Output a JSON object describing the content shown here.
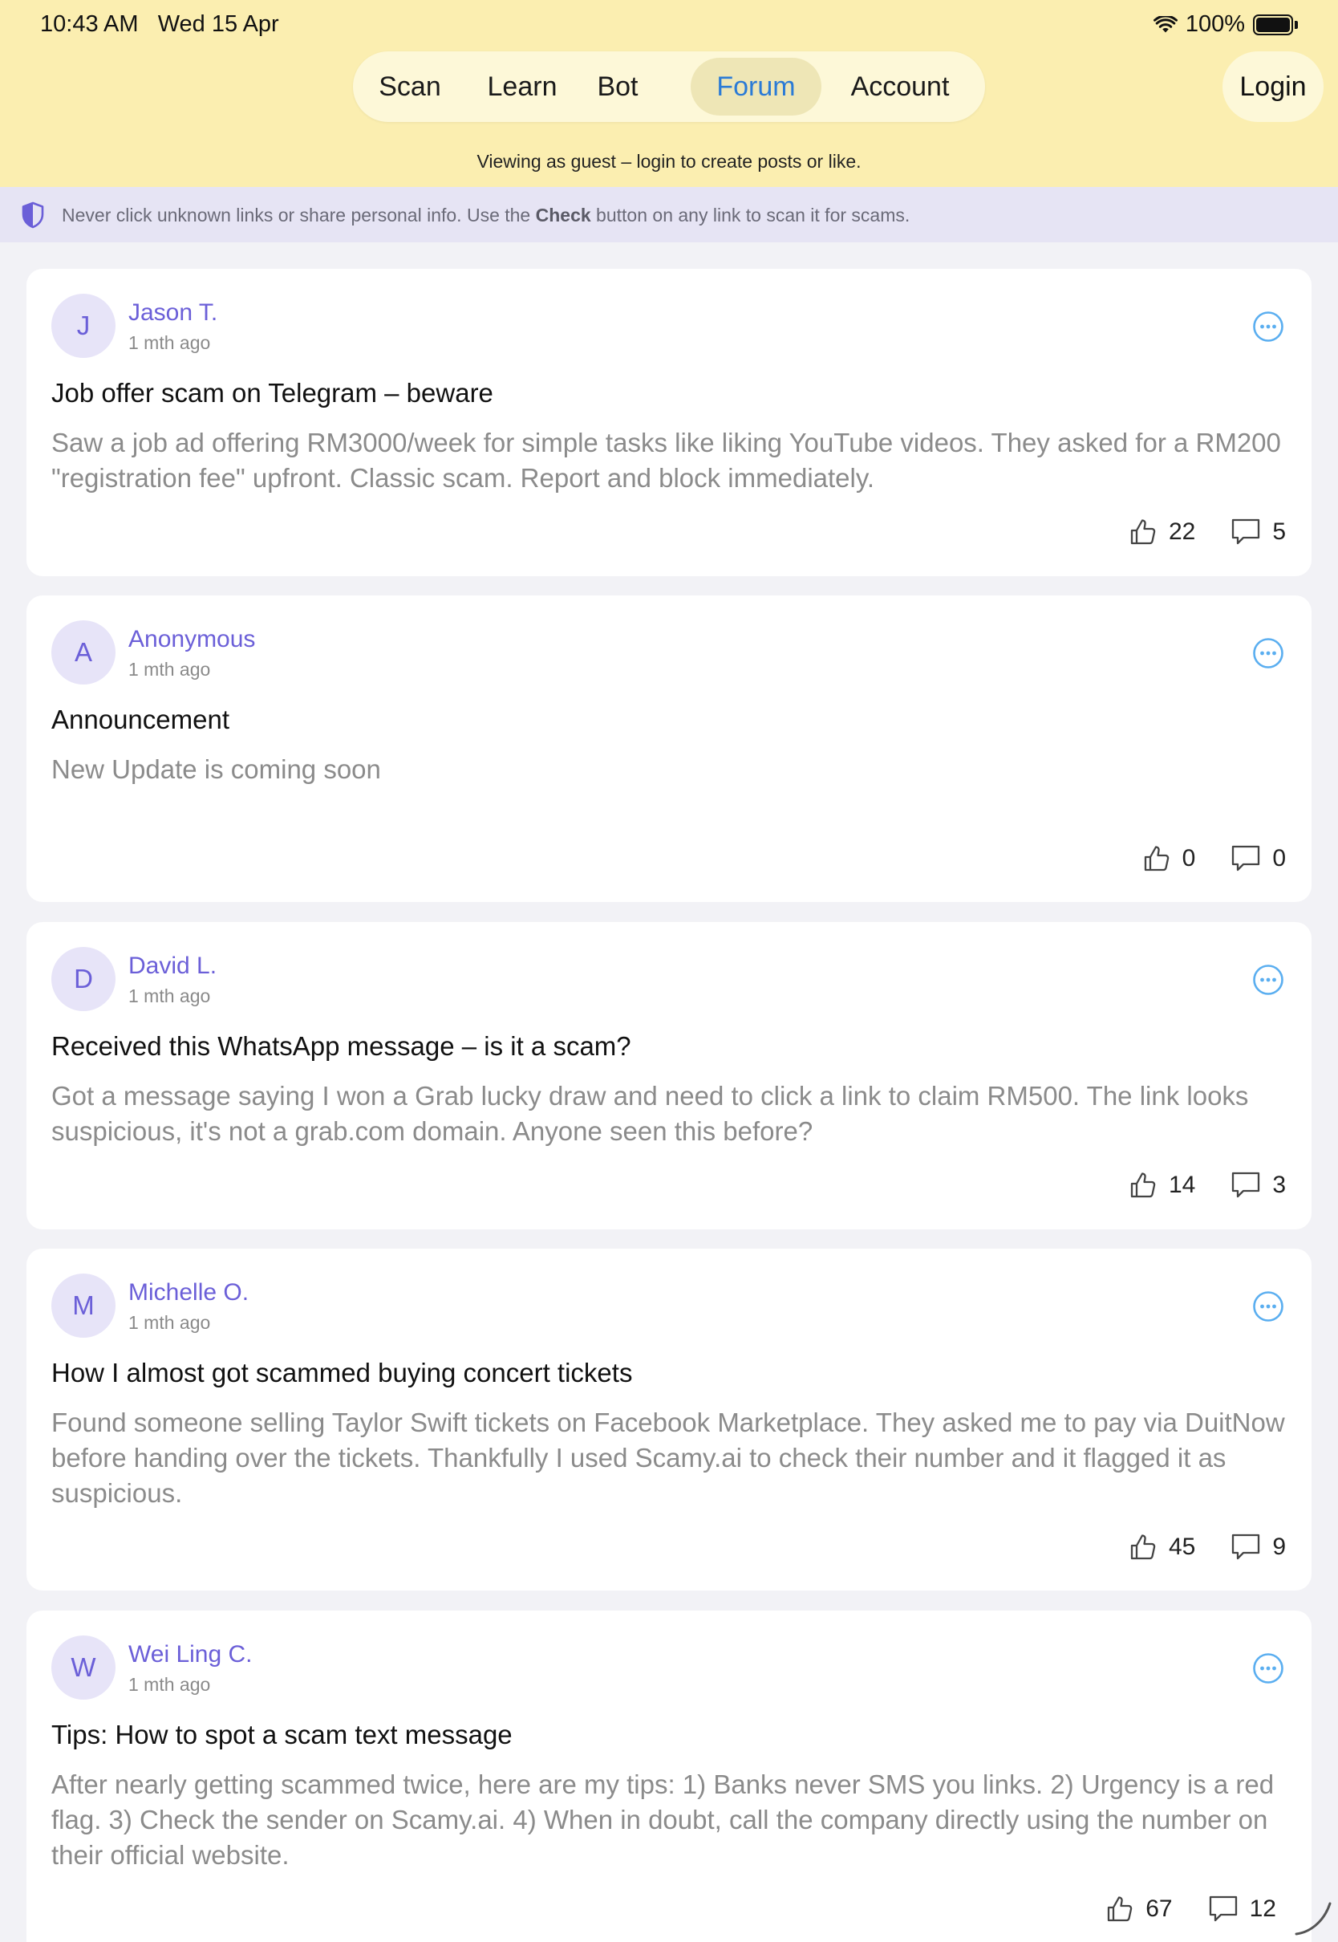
{
  "status": {
    "time": "10:43 AM",
    "date": "Wed 15 Apr",
    "battery": "100%"
  },
  "nav": {
    "tabs": [
      {
        "label": "Scan"
      },
      {
        "label": "Learn"
      },
      {
        "label": "Bot"
      },
      {
        "label": "Forum"
      },
      {
        "label": "Account"
      }
    ],
    "active": "Forum",
    "login_label": "Login"
  },
  "guest_note": "Viewing as guest – login to create posts or like.",
  "banner": {
    "text_before": "Never click unknown links or share personal info. Use the ",
    "text_bold": "Check",
    "text_after": " button on any link to scan it for scams."
  },
  "posts": [
    {
      "initial": "J",
      "author": "Jason T.",
      "time": "1 mth ago",
      "title": "Job offer scam on Telegram – beware",
      "body": "Saw a job ad offering RM3000/week for simple tasks like liking YouTube videos. They asked for a RM200 \"registration fee\" upfront. Classic scam. Report and block immediately.",
      "likes": "22",
      "comments": "5"
    },
    {
      "initial": "A",
      "author": "Anonymous",
      "time": "1 mth ago",
      "title": "Announcement",
      "body": "New Update is coming soon",
      "likes": "0",
      "comments": "0"
    },
    {
      "initial": "D",
      "author": "David L.",
      "time": "1 mth ago",
      "title": "Received this WhatsApp message – is it a scam?",
      "body": "Got a message saying I won a Grab lucky draw and need to click a link to claim RM500. The link looks suspicious, it's not a grab.com domain. Anyone seen this before?",
      "likes": "14",
      "comments": "3"
    },
    {
      "initial": "M",
      "author": "Michelle O.",
      "time": "1 mth ago",
      "title": "How I almost got scammed buying concert tickets",
      "body": "Found someone selling Taylor Swift tickets on Facebook Marketplace. They asked me to pay via DuitNow before handing over the tickets. Thankfully I used Scamy.ai to check their number and it flagged it as suspicious.",
      "likes": "45",
      "comments": "9"
    },
    {
      "initial": "W",
      "author": "Wei Ling C.",
      "time": "1 mth ago",
      "title": "Tips: How to spot a scam text message",
      "body": "After nearly getting scammed twice, here are my tips: 1) Banks never SMS you links. 2) Urgency is a red flag. 3) Check the sender on Scamy.ai. 4) When in doubt, call the company directly using the number on their official website.",
      "likes": "67",
      "comments": "12"
    }
  ],
  "colors": {
    "header_bg": "#fbeeb0",
    "nav_pill_bg": "#fdf8d8",
    "active_tab": "#2b7bd6",
    "author": "#6b5fd8",
    "avatar_bg": "#e7e4f8",
    "banner_bg": "#e6e4f4",
    "page_bg": "#f2f2f6",
    "more_icon": "#5aaef0"
  },
  "icons": {
    "wifi": "wifi-icon",
    "battery": "battery-icon",
    "shield": "shield-icon",
    "more": "more-horizontal-circle-icon",
    "like": "thumbs-up-icon",
    "comment": "comment-bubble-icon"
  }
}
